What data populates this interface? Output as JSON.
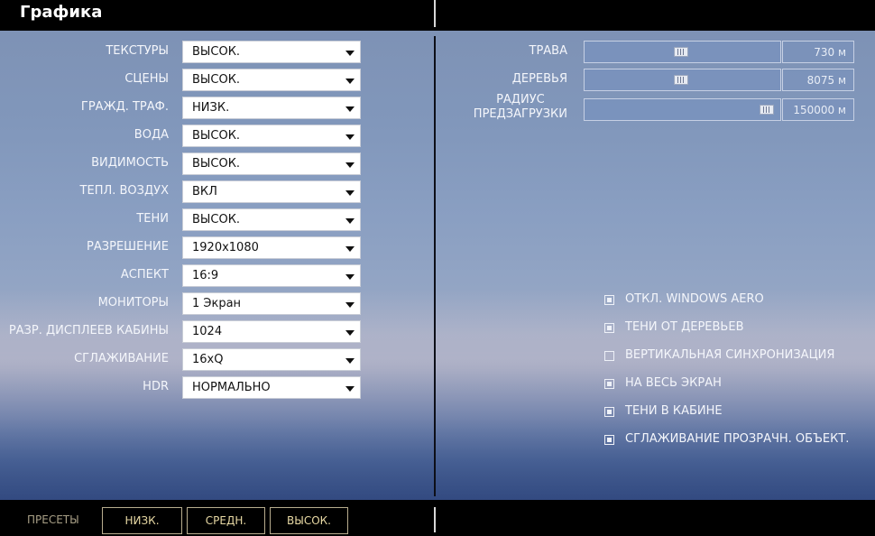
{
  "window": {
    "title": "Графика"
  },
  "left_settings": [
    {
      "label": "ТЕКСТУРЫ",
      "value": "ВЫСОК."
    },
    {
      "label": "СЦЕНЫ",
      "value": "ВЫСОК."
    },
    {
      "label": "ГРАЖД. ТРАФ.",
      "value": "НИЗК."
    },
    {
      "label": "ВОДА",
      "value": "ВЫСОК."
    },
    {
      "label": "ВИДИМОСТЬ",
      "value": "ВЫСОК."
    },
    {
      "label": "ТЕПЛ. ВОЗДУХ",
      "value": "ВКЛ"
    },
    {
      "label": "ТЕНИ",
      "value": "ВЫСОК."
    },
    {
      "label": "РАЗРЕШЕНИЕ",
      "value": "1920x1080"
    },
    {
      "label": "АСПЕКТ",
      "value": "16:9"
    },
    {
      "label": "МОНИТОРЫ",
      "value": "1 Экран"
    },
    {
      "label": "РАЗР. ДИСПЛЕЕВ КАБИНЫ",
      "value": "1024"
    },
    {
      "label": "СГЛАЖИВАНИЕ",
      "value": "16xQ"
    },
    {
      "label": "HDR",
      "value": "НОРМАЛЬНО"
    }
  ],
  "sliders": [
    {
      "label": "ТРАВА",
      "value": "730 м",
      "level": 0.49
    },
    {
      "label": "ДЕРЕВЬЯ",
      "value": "8075 м",
      "level": 0.49
    },
    {
      "label": "РАДИУС\nПРЕДЗАГРУЗКИ",
      "value": "150000 м",
      "level": 0.97
    }
  ],
  "checkboxes": [
    {
      "label": "ОТКЛ. WINDOWS AERO",
      "checked": true
    },
    {
      "label": "ТЕНИ ОТ ДЕРЕВЬЕВ",
      "checked": true
    },
    {
      "label": "ВЕРТИКАЛЬНАЯ СИНХРОНИЗАЦИЯ",
      "checked": false
    },
    {
      "label": "НА ВЕСЬ ЭКРАН",
      "checked": true
    },
    {
      "label": "ТЕНИ В КАБИНЕ",
      "checked": true
    },
    {
      "label": "СГЛАЖИВАНИЕ ПРОЗРАЧН. ОБЪЕКТ.",
      "checked": true
    }
  ],
  "presets": {
    "label": "ПРЕСЕТЫ",
    "buttons": [
      "НИЗК.",
      "СРЕДН.",
      "ВЫСОК."
    ]
  },
  "colors": {
    "preset_text": "#e8d9a4",
    "label_text": "#f4f6fb",
    "slider_track": "#7891be"
  },
  "icons": {
    "dropdown": "chevron-down-icon",
    "slider_thumb": "grip-icon"
  }
}
